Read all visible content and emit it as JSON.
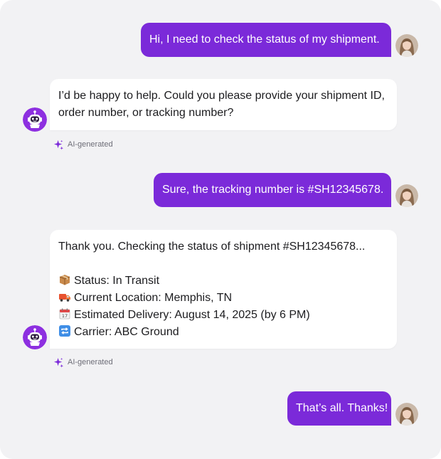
{
  "messages": [
    {
      "role": "user",
      "text": "Hi, I need to check the status of my shipment."
    },
    {
      "role": "bot",
      "lines": [
        "I’d be happy to help. Could you please provide your shipment ID,",
        "order number, or tracking number?"
      ],
      "tag": "AI-generated"
    },
    {
      "role": "user",
      "text": "Sure, the tracking number is #SH12345678."
    },
    {
      "role": "bot",
      "lines": [
        "Thank you. Checking the status of shipment #SH12345678...",
        "Status: In Transit",
        "Current Location: Memphis, TN",
        "Estimated Delivery: August 14, 2025 (by 6 PM)",
        "Carrier: ABC Ground"
      ],
      "line_icons": [
        "",
        "package-icon",
        "truck-icon",
        "calendar-icon",
        "repeat-icon"
      ],
      "tag": "AI-generated"
    },
    {
      "role": "user",
      "text": "That’s all. Thanks!"
    }
  ],
  "colors": {
    "panel_bg": "#f2f2f4",
    "user_bubble": "#7b2ad9",
    "bot_bubble": "#ffffff",
    "tag_accent": "#7b2ad9"
  }
}
